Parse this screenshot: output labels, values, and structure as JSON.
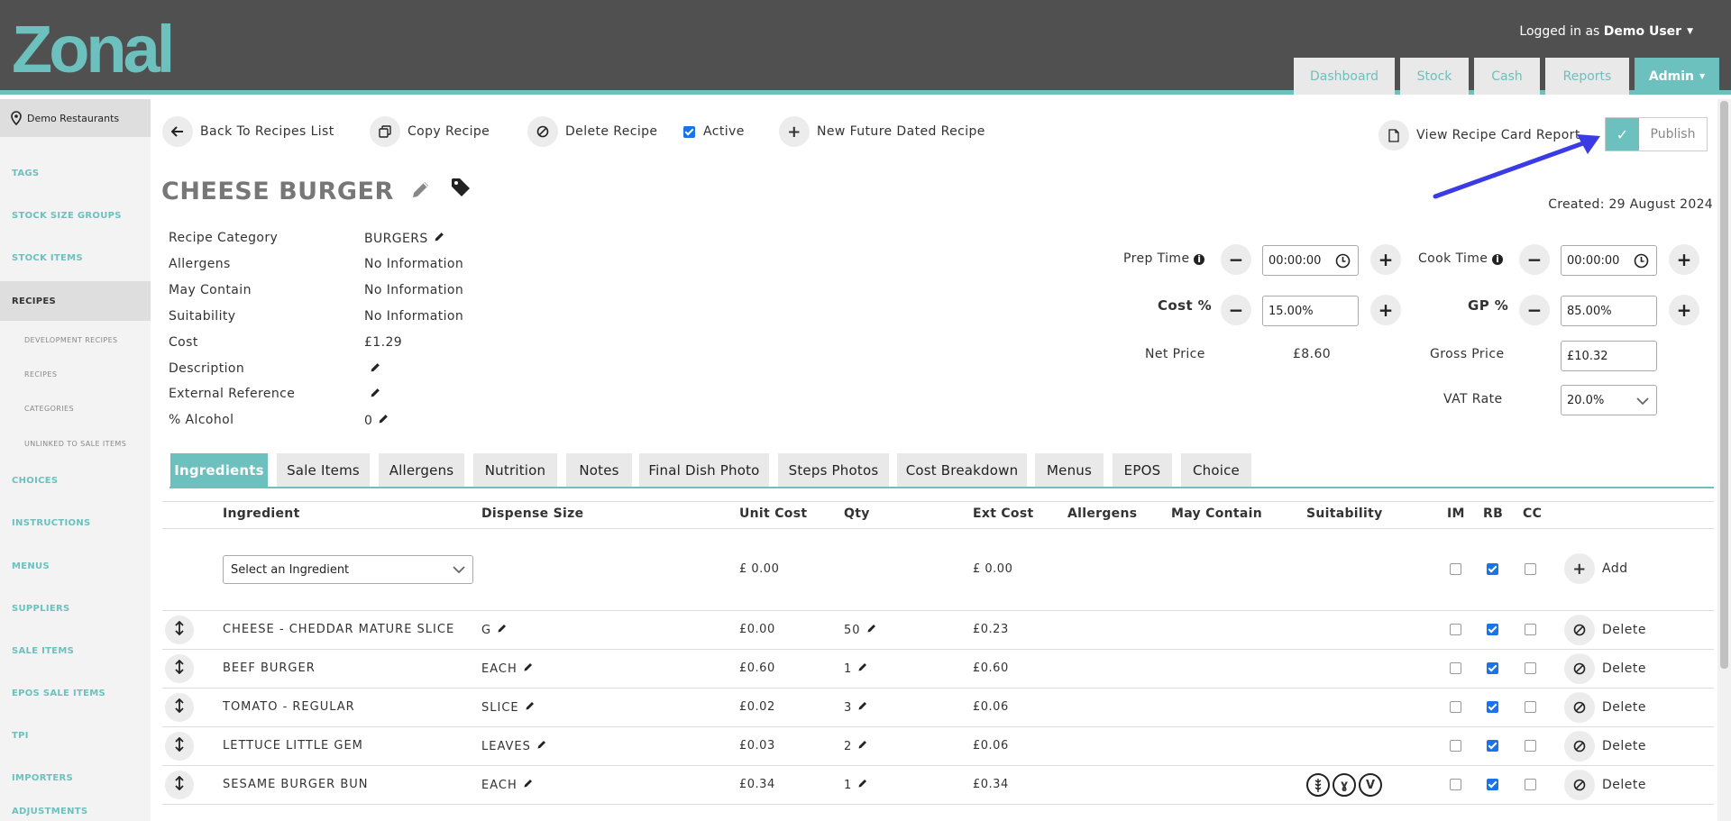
{
  "header": {
    "logo_text": "Zonal",
    "user_prefix": "Logged in as",
    "user_name": "Demo User",
    "nav": [
      "Dashboard",
      "Stock",
      "Cash",
      "Reports",
      "Admin"
    ]
  },
  "sidebar": {
    "org": "Demo Restaurants",
    "items": [
      "TAGS",
      "STOCK SIZE GROUPS",
      "STOCK ITEMS",
      "RECIPES",
      "CHOICES",
      "INSTRUCTIONS",
      "MENUS",
      "SUPPLIERS",
      "SALE ITEMS",
      "EPOS SALE ITEMS",
      "TPI",
      "IMPORTERS",
      "ADJUSTMENTS"
    ],
    "subitems": [
      "DEVELOPMENT RECIPES",
      "RECIPES",
      "CATEGORIES",
      "UNLINKED TO SALE ITEMS"
    ]
  },
  "toolbar": {
    "back": "Back To Recipes List",
    "copy": "Copy Recipe",
    "delete": "Delete Recipe",
    "active": "Active",
    "new_future": "New Future Dated Recipe",
    "view_report": "View Recipe Card Report",
    "publish": "Publish",
    "publish_tick": "✓"
  },
  "recipe": {
    "title": "CHEESE BURGER",
    "created": "Created: 29 August 2024",
    "props": [
      {
        "label": "Recipe Category",
        "value": "BURGERS"
      },
      {
        "label": "Allergens",
        "value": "No Information"
      },
      {
        "label": "May Contain",
        "value": "No Information"
      },
      {
        "label": "Suitability",
        "value": "No Information"
      },
      {
        "label": "Cost",
        "value": "£1.29"
      },
      {
        "label": "Description",
        "value": ""
      },
      {
        "label": "External Reference",
        "value": ""
      },
      {
        "label": "% Alcohol",
        "value": "0"
      }
    ]
  },
  "form": {
    "prep_label": "Prep Time",
    "prep_value": "00:00:00",
    "cook_label": "Cook Time",
    "cook_value": "00:00:00",
    "cost_label": "Cost %",
    "cost_value": "15.00%",
    "gp_label": "GP %",
    "gp_value": "85.00%",
    "net_label": "Net Price",
    "net_value": "£8.60",
    "gross_label": "Gross Price",
    "gross_value": "£10.32",
    "vat_label": "VAT Rate",
    "vat_value": "20.0%",
    "minus": "−",
    "plus": "+"
  },
  "tabs": [
    "Ingredients",
    "Sale Items",
    "Allergens",
    "Nutrition",
    "Notes",
    "Final Dish Photo",
    "Steps Photos",
    "Cost Breakdown",
    "Menus",
    "EPOS",
    "Choice"
  ],
  "table": {
    "headers": {
      "ingredient": "Ingredient",
      "dispense": "Dispense Size",
      "unit_cost": "Unit Cost",
      "qty": "Qty",
      "ext_cost": "Ext Cost",
      "allergens": "Allergens",
      "may_contain": "May Contain",
      "suitability": "Suitability",
      "im": "IM",
      "rb": "RB",
      "cc": "CC"
    },
    "new_row": {
      "select_placeholder": "Select an Ingredient",
      "unit_cost": "£ 0.00",
      "ext_cost": "£ 0.00",
      "add": "Add"
    },
    "rows": [
      {
        "name": "CHEESE - CHEDDAR MATURE SLICE",
        "dispense": "G",
        "unit_cost": "£0.00",
        "qty": "50",
        "ext_cost": "£0.23",
        "action": "Delete"
      },
      {
        "name": "BEEF BURGER",
        "dispense": "EACH",
        "unit_cost": "£0.60",
        "qty": "1",
        "ext_cost": "£0.60",
        "action": "Delete"
      },
      {
        "name": "TOMATO - REGULAR",
        "dispense": "SLICE",
        "unit_cost": "£0.02",
        "qty": "3",
        "ext_cost": "£0.06",
        "action": "Delete"
      },
      {
        "name": "LETTUCE LITTLE GEM",
        "dispense": "LEAVES",
        "unit_cost": "£0.03",
        "qty": "2",
        "ext_cost": "£0.06",
        "action": "Delete"
      },
      {
        "name": "SESAME BURGER BUN",
        "dispense": "EACH",
        "unit_cost": "£0.34",
        "qty": "1",
        "ext_cost": "£0.34",
        "action": "Delete"
      }
    ],
    "suitability_icons": [
      "wheat-icon",
      "vegan-icon",
      "vegetarian-icon"
    ],
    "suitability_glyphs": [
      "ɣ",
      "V"
    ]
  },
  "colors": {
    "accent": "#6cc0bd",
    "header_bg": "#505050",
    "annotation_arrow": "#3b3be6"
  }
}
